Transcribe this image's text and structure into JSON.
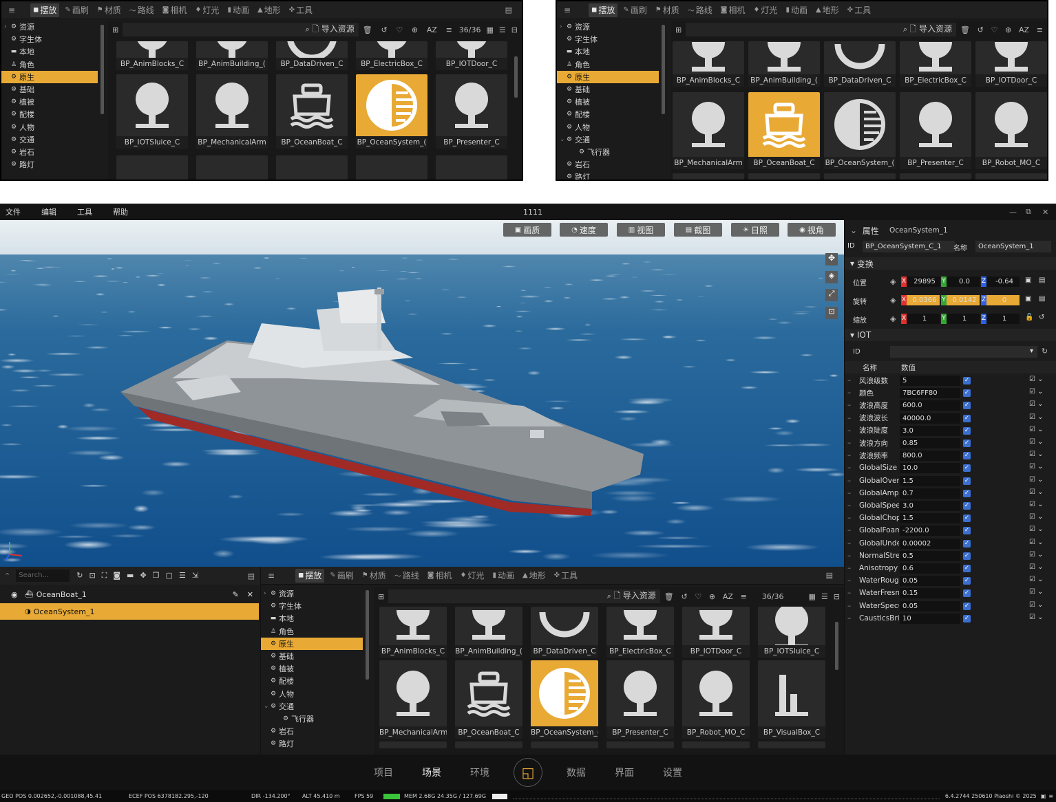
{
  "asset_panel": {
    "menu_icon": "menu-icon",
    "tabs": [
      {
        "label": "摆放",
        "icon": "cube-icon",
        "active": true
      },
      {
        "label": "画刷",
        "icon": "brush-icon",
        "active": false
      },
      {
        "label": "材质",
        "icon": "paint-icon",
        "active": false
      },
      {
        "label": "路线",
        "icon": "route-icon",
        "active": false
      },
      {
        "label": "相机",
        "icon": "camera-icon",
        "active": false
      },
      {
        "label": "灯光",
        "icon": "light-icon",
        "active": false
      },
      {
        "label": "动画",
        "icon": "film-icon",
        "active": false
      },
      {
        "label": "地形",
        "icon": "terrain-icon",
        "active": false
      },
      {
        "label": "工具",
        "icon": "wrench-icon",
        "active": false
      }
    ],
    "tree": [
      {
        "label": "资源",
        "arrow": "›",
        "icon": "gear-icon"
      },
      {
        "label": "字生体",
        "arrow": "",
        "icon": "gear-icon"
      },
      {
        "label": "本地",
        "arrow": "",
        "icon": "folder-icon"
      },
      {
        "label": "角色",
        "arrow": "",
        "icon": "person-icon"
      },
      {
        "label": "原生",
        "arrow": "",
        "icon": "gear-icon",
        "selected": true
      },
      {
        "label": "基础",
        "arrow": "",
        "icon": "gear-icon"
      },
      {
        "label": "植被",
        "arrow": "",
        "icon": "gear-icon"
      },
      {
        "label": "配楼",
        "arrow": "",
        "icon": "gear-icon"
      },
      {
        "label": "人物",
        "arrow": "",
        "icon": "gear-icon"
      },
      {
        "label": "交通",
        "arrow": "",
        "icon": "gear-icon"
      },
      {
        "label": "岩石",
        "arrow": "",
        "icon": "gear-icon"
      },
      {
        "label": "路灯",
        "arrow": "",
        "icon": "gear-icon"
      }
    ],
    "tree2": [
      {
        "label": "资源",
        "arrow": "›",
        "icon": "gear-icon"
      },
      {
        "label": "字生体",
        "arrow": "",
        "icon": "gear-icon"
      },
      {
        "label": "本地",
        "arrow": "",
        "icon": "folder-icon"
      },
      {
        "label": "角色",
        "arrow": "",
        "icon": "person-icon"
      },
      {
        "label": "原生",
        "arrow": "",
        "icon": "gear-icon",
        "selected": true
      },
      {
        "label": "基础",
        "arrow": "",
        "icon": "gear-icon"
      },
      {
        "label": "植被",
        "arrow": "",
        "icon": "gear-icon"
      },
      {
        "label": "配楼",
        "arrow": "",
        "icon": "gear-icon"
      },
      {
        "label": "人物",
        "arrow": "",
        "icon": "gear-icon"
      },
      {
        "label": "交通",
        "arrow": "⌄",
        "icon": "gear-icon"
      },
      {
        "label": "飞行器",
        "arrow": "",
        "icon": "gear-icon",
        "indent": true
      },
      {
        "label": "岩石",
        "arrow": "",
        "icon": "gear-icon"
      },
      {
        "label": "路灯",
        "arrow": "",
        "icon": "gear-icon"
      }
    ],
    "import_label": "导入资源",
    "count": "36/36",
    "row1": [
      "BP_AnimBlocks_C",
      "BP_AnimBuilding_(",
      "BP_DataDriven_C",
      "BP_ElectricBox_C",
      "BP_IOTDoor_C",
      "BP_IOTSluice_C"
    ],
    "row2": [
      "BP_IOTSluice_C",
      "BP_MechanicalArm",
      "BP_OceanBoat_C",
      "BP_OceanSystem_(",
      "BP_Presenter_C"
    ],
    "row2b": [
      "BP_MechanicalArm",
      "BP_OceanBoat_C",
      "BP_OceanSystem_(",
      "BP_Presenter_C",
      "BP_Robot_MO_C",
      "BP_VisualBox_C"
    ]
  },
  "app": {
    "title": "1111",
    "menus": [
      "文件",
      "编辑",
      "工具",
      "帮助"
    ],
    "window_controls": [
      "—",
      "⧉",
      "✕"
    ],
    "viewport_buttons": [
      {
        "label": "画质",
        "icon": "image-icon"
      },
      {
        "label": "速度",
        "icon": "speed-icon"
      },
      {
        "label": "视图",
        "icon": "view-icon"
      },
      {
        "label": "截图",
        "icon": "screenshot-icon"
      },
      {
        "label": "日照",
        "icon": "sun-icon"
      },
      {
        "label": "视角",
        "icon": "eye-icon"
      }
    ],
    "outliner": {
      "search_placeholder": "Search...",
      "items": [
        {
          "label": "OceanBoat_1",
          "selected": false
        },
        {
          "label": "OceanSystem_1",
          "selected": true
        }
      ]
    },
    "properties": {
      "header": "属性",
      "object_name": "OceanSystem_1",
      "id_label": "ID",
      "id_value": "BP_OceanSystem_C_1",
      "name_label": "名称",
      "name_value": "OceanSystem_1",
      "transform_label": "变换",
      "position_label": "位置",
      "rotation_label": "旋转",
      "scale_label": "缩放",
      "pos": {
        "x": "29895",
        "y": "0.0",
        "z": "-0.64"
      },
      "rot": {
        "x": "0.0366",
        "y": "0.0142",
        "z": "0"
      },
      "scl": {
        "x": "1",
        "y": "1",
        "z": "1"
      },
      "iot_label": "IOT",
      "iot_id_label": "ID",
      "col_name": "名称",
      "col_value": "数值",
      "params": [
        {
          "name": "风浪级数",
          "value": "5"
        },
        {
          "name": "颜色",
          "value": "7BC6FF80"
        },
        {
          "name": "波浪高度",
          "value": "600.0"
        },
        {
          "name": "波浪波长",
          "value": "40000.0"
        },
        {
          "name": "波浪陡度",
          "value": "3.0"
        },
        {
          "name": "波浪方向",
          "value": "0.85"
        },
        {
          "name": "波浪频率",
          "value": "800.0"
        },
        {
          "name": "GlobalSize",
          "value": "10.0"
        },
        {
          "name": "GlobalOvera",
          "value": "1.5"
        },
        {
          "name": "GlobalAmpl",
          "value": "0.7"
        },
        {
          "name": "GlobalSpee",
          "value": "3.0"
        },
        {
          "name": "GlobalChop",
          "value": "1.5"
        },
        {
          "name": "GlobalFoam",
          "value": "-2200.0"
        },
        {
          "name": "GlobalUnde",
          "value": "0.00002"
        },
        {
          "name": "NormalStre",
          "value": "0.5"
        },
        {
          "name": "Anisotropy",
          "value": "0.6"
        },
        {
          "name": "WaterRougl",
          "value": "0.05"
        },
        {
          "name": "WaterFresn",
          "value": "0.15"
        },
        {
          "name": "WaterSpecu",
          "value": "0.05"
        },
        {
          "name": "CausticsBri",
          "value": "10"
        }
      ]
    },
    "bottom_nav": [
      "项目",
      "场景",
      "环境",
      "数据",
      "界面",
      "设置"
    ],
    "bottom_nav_active": "场景",
    "status": {
      "geo": "GEO POS 0.002652,-0.001088,45.41",
      "ecef": "ECEF POS 6378182.295,-120",
      "dir": "DIR  -134.200°",
      "alt": "ALT  45.410 m",
      "fps": "FPS  59",
      "mem": "MEM  2.68G  24.35G / 127.69G",
      "version": "6.4.2744 250610  Piaoshi © 2025"
    },
    "colors": {
      "accent": "#e8a935",
      "ocean": "#1f5a8f",
      "sky": "#dfe8ee"
    }
  }
}
